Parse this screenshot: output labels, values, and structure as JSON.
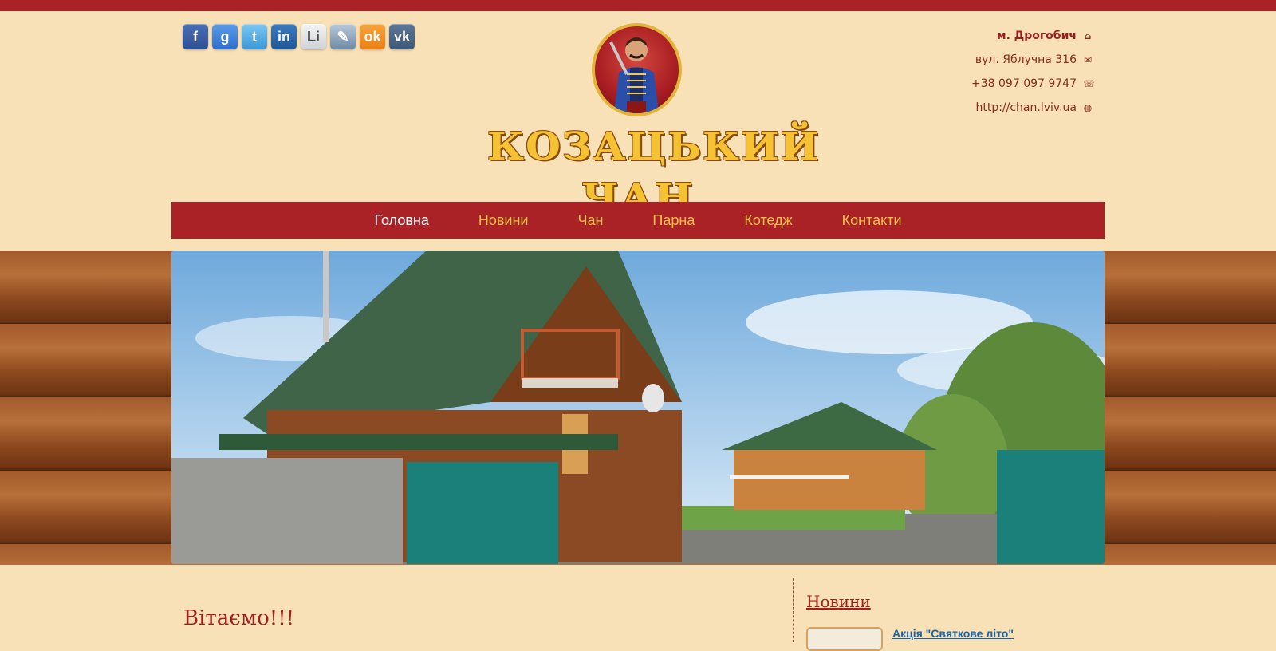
{
  "colors": {
    "top_bar": "#ab2226",
    "background": "#f9e1b7",
    "nav_bg": "#ab2226",
    "nav_link": "#f5c24a",
    "nav_active": "#ffffff",
    "heading": "#a01e1e",
    "link": "#1a62a6"
  },
  "social": [
    {
      "icon": "facebook-icon",
      "glyph": "f"
    },
    {
      "icon": "google-icon",
      "glyph": "g"
    },
    {
      "icon": "twitter-icon",
      "glyph": "t"
    },
    {
      "icon": "linkedin-icon",
      "glyph": "in"
    },
    {
      "icon": "liveinternet-icon",
      "glyph": "Li"
    },
    {
      "icon": "livejournal-icon",
      "glyph": "✎"
    },
    {
      "icon": "odnoklassniki-icon",
      "glyph": "ok"
    },
    {
      "icon": "vk-icon",
      "glyph": "vk"
    }
  ],
  "logo": {
    "title": "КОЗАЦЬКИЙ ЧАН"
  },
  "contacts": {
    "city": "м. Дрогобич",
    "address": "вул. Яблучна 316",
    "phone": "+38 097 097 9747",
    "website": "http://chan.lviv.ua"
  },
  "nav": {
    "items": [
      "Головна",
      "Новини",
      "Чан",
      "Парна",
      "Котедж",
      "Контакти"
    ]
  },
  "main": {
    "welcome": "Вітаємо!!!",
    "sidebar": {
      "title": "Новини",
      "first_item": "Акція \"Святкове літо\""
    }
  }
}
